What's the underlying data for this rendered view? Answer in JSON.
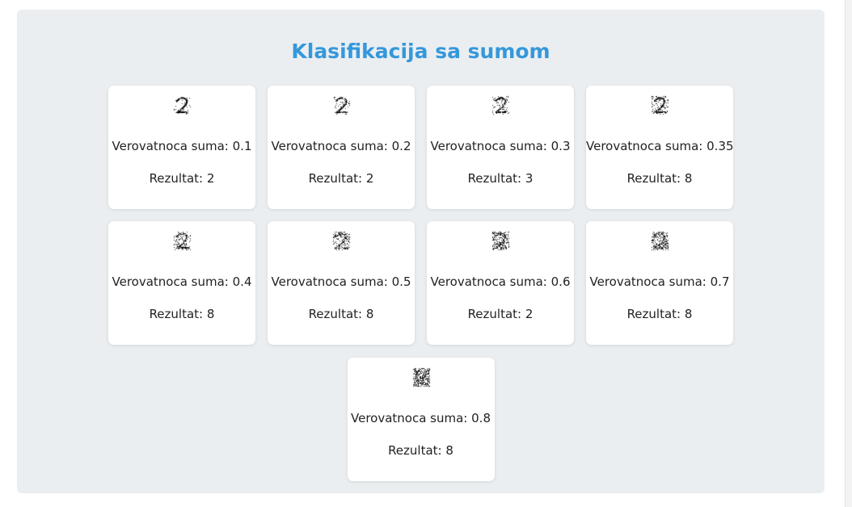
{
  "title": "Klasifikacija sa sumom",
  "cards": [
    {
      "probability_label": "Verovatnoca suma: 0.1",
      "result_label": "Rezultat: 2",
      "noise": 0.1
    },
    {
      "probability_label": "Verovatnoca suma: 0.2",
      "result_label": "Rezultat: 2",
      "noise": 0.2
    },
    {
      "probability_label": "Verovatnoca suma: 0.3",
      "result_label": "Rezultat: 3",
      "noise": 0.3
    },
    {
      "probability_label": "Verovatnoca suma: 0.35",
      "result_label": "Rezultat: 8",
      "noise": 0.35
    },
    {
      "probability_label": "Verovatnoca suma: 0.4",
      "result_label": "Rezultat: 8",
      "noise": 0.4
    },
    {
      "probability_label": "Verovatnoca suma: 0.5",
      "result_label": "Rezultat: 8",
      "noise": 0.5
    },
    {
      "probability_label": "Verovatnoca suma: 0.6",
      "result_label": "Rezultat: 2",
      "noise": 0.6
    },
    {
      "probability_label": "Verovatnoca suma: 0.7",
      "result_label": "Rezultat: 8",
      "noise": 0.7
    },
    {
      "probability_label": "Verovatnoca suma: 0.8",
      "result_label": "Rezultat: 8",
      "noise": 0.8
    }
  ],
  "colors": {
    "title": "#3498db",
    "panel": "#ebeef0",
    "card": "#ffffff",
    "text": "#222222"
  }
}
